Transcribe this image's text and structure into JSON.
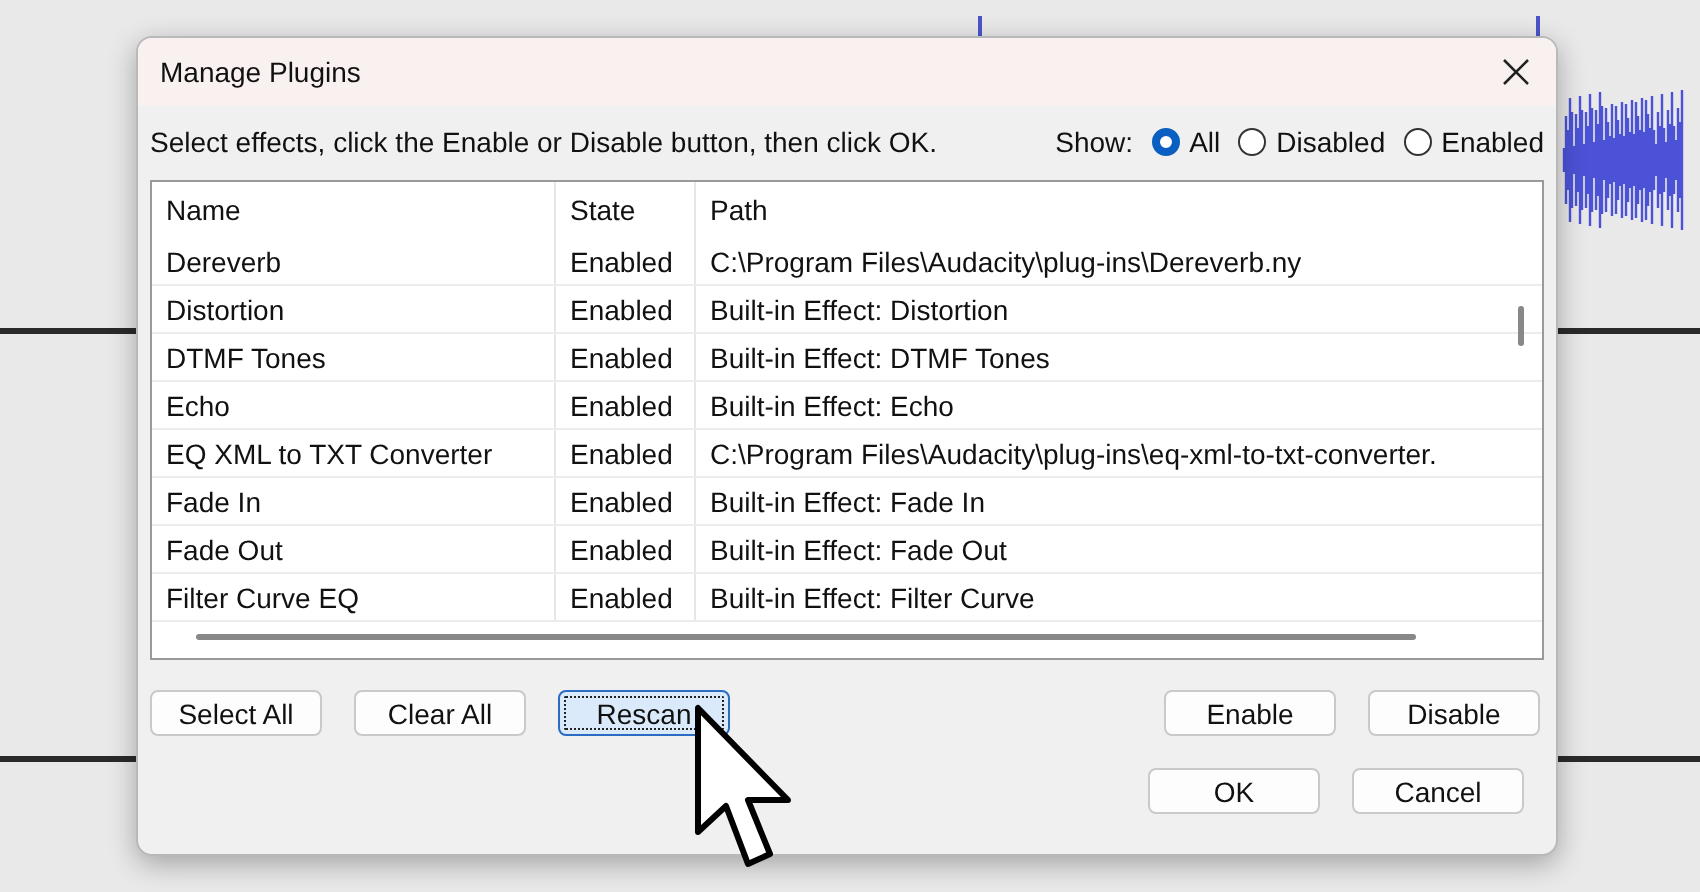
{
  "window": {
    "title": "Manage Plugins"
  },
  "instruction": "Select effects, click the Enable or Disable button, then click OK.",
  "show": {
    "label": "Show:",
    "options": [
      {
        "label": "All",
        "selected": true
      },
      {
        "label": "Disabled",
        "selected": false
      },
      {
        "label": "Enabled",
        "selected": false
      }
    ]
  },
  "table": {
    "columns": [
      "Name",
      "State",
      "Path"
    ],
    "rows": [
      [
        "Dereverb",
        "Enabled",
        "C:\\Program Files\\Audacity\\plug-ins\\Dereverb.ny"
      ],
      [
        "Distortion",
        "Enabled",
        "Built-in Effect: Distortion"
      ],
      [
        "DTMF Tones",
        "Enabled",
        "Built-in Effect: DTMF Tones"
      ],
      [
        "Echo",
        "Enabled",
        "Built-in Effect: Echo"
      ],
      [
        "EQ XML to TXT Converter",
        "Enabled",
        "C:\\Program Files\\Audacity\\plug-ins\\eq-xml-to-txt-converter."
      ],
      [
        "Fade In",
        "Enabled",
        "Built-in Effect: Fade In"
      ],
      [
        "Fade Out",
        "Enabled",
        "Built-in Effect: Fade Out"
      ],
      [
        "Filter Curve EQ",
        "Enabled",
        "Built-in Effect: Filter Curve"
      ]
    ]
  },
  "left_buttons": [
    {
      "label": "Select All",
      "focused": false
    },
    {
      "label": "Clear All",
      "focused": false
    },
    {
      "label": "Rescan",
      "focused": true
    }
  ],
  "right_buttons": [
    {
      "label": "Enable",
      "focused": false
    },
    {
      "label": "Disable",
      "focused": false
    }
  ],
  "dialog_buttons": [
    {
      "label": "OK",
      "focused": false
    },
    {
      "label": "Cancel",
      "focused": false
    }
  ]
}
